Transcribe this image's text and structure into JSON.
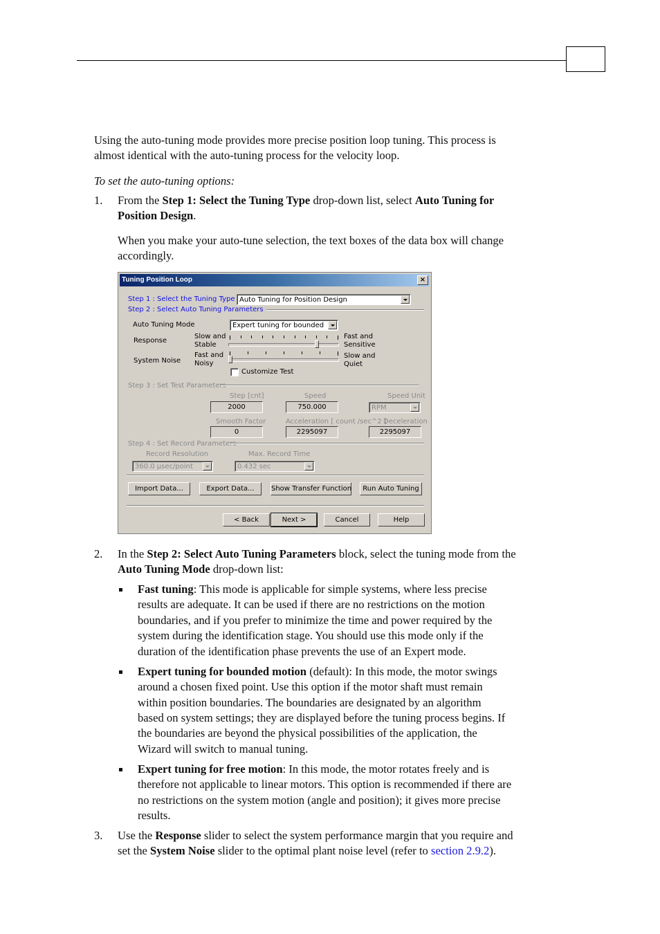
{
  "header": {
    "page_box_label": ""
  },
  "intro": {
    "line1": "Using the auto-tuning mode provides more precise position loop tuning. This process is",
    "line2": "almost identical with the auto-tuning process for the velocity loop.",
    "procedure_title": "To set the auto-tuning options:"
  },
  "steps": [
    {
      "number": "1.",
      "line1_a": "From the ",
      "line1_b": "Step 1: Select the Tuning Type",
      "line1_c": " drop-down list, select ",
      "line1_d": "Auto Tuning for",
      "line2_b": "Position Design",
      "line2_c": ".",
      "note1": "When you make your auto-tune selection, the text boxes of the data box will change",
      "note2": "accordingly."
    },
    {
      "number": "2.",
      "line1_a": "In the ",
      "line1_b": "Step 2: Select Auto Tuning Parameters",
      "line1_c": " block, select the tuning mode from the",
      "line2_b": "Auto Tuning Mode",
      "line2_c": " drop-down list:",
      "bullets": [
        {
          "term": "Fast tuning",
          "lines": [
            ": This mode is applicable for simple systems, where less precise",
            "results are adequate. It can be used if there are no restrictions on the motion",
            "boundaries, and if you prefer to minimize the time and power required by the",
            "system during the identification stage. You should use this mode only if the",
            "duration of the identification phase prevents the use of an Expert mode."
          ]
        },
        {
          "term": "Expert tuning for bounded motion",
          "lines": [
            " (default): In this mode, the motor swings",
            "around a chosen fixed point. Use this option if the motor shaft must remain",
            "within position boundaries. The boundaries are designated by an algorithm",
            "based on system settings; they are displayed before the tuning process begins. If",
            "the boundaries are beyond the physical possibilities of the application, the",
            "Wizard will switch to manual tuning."
          ]
        },
        {
          "term": "Expert tuning for free motion",
          "lines": [
            ": In this mode, the motor rotates freely and is",
            "therefore not applicable to linear motors. This option is recommended if there are",
            "no restrictions on the system motion (angle and position); it gives more precise",
            "results."
          ]
        }
      ]
    },
    {
      "number": "3.",
      "line1_a": "Use the ",
      "line1_b": "Response",
      "line1_c": " slider to select the system performance margin that you require and",
      "line2_a": "set the ",
      "line2_b": "System Noise",
      "line2_c": " slider to the optimal plant noise level (refer to ",
      "link": "section 2.9.2",
      "line2_d": ")."
    }
  ],
  "dialog": {
    "title": "Tuning Position Loop",
    "close_label": "×",
    "step1_label": "Step 1 : Select the  Tuning Type",
    "tuning_type_value": "Auto Tuning for Position Design",
    "step2_label": "Step 2 :  Select Auto Tuning Parameters",
    "auto_tuning_mode_label": "Auto Tuning Mode",
    "auto_tuning_mode_value": "Expert tuning for bounded",
    "response_label": "Response",
    "response_left_1": "Slow and",
    "response_left_2": "Stable",
    "response_right_1": "Fast and",
    "response_right_2": "Sensitive",
    "response_ticks": 11,
    "response_value_fraction": 0.8,
    "noise_label": "System Noise",
    "noise_left_1": "Fast and",
    "noise_left_2": "Noisy",
    "noise_right_1": "Slow and",
    "noise_right_2": "Quiet",
    "noise_ticks": 7,
    "noise_value_fraction": 0.0,
    "customize_label": "Customize Test",
    "customize_checked": false,
    "step3_label": "Step 3 : Set Test  Parameters",
    "step_cnt_label": "Step [cnt]",
    "step_cnt_value": "2000",
    "speed_label": "Speed",
    "speed_value": "750.000",
    "speed_unit_label": "Speed Unit",
    "speed_unit_value": "RPM",
    "smooth_label": "Smooth Factor",
    "smooth_value": "0",
    "accel_label": "Acceleration   [ count /sec^2 ]",
    "accel_value": "2295097",
    "decel_label": "Deceleration",
    "decel_value": "2295097",
    "step4_label": "Step 4 : Set Record Parameters",
    "record_res_label": "Record Resolution",
    "record_res_value": "360.0 µsec/point",
    "max_time_label": "Max. Record Time",
    "max_time_value": "0.432 sec",
    "buttons": {
      "import": "Import Data...",
      "export": "Export Data...",
      "transfer": "Show Transfer Function",
      "run": "Run Auto Tuning",
      "back": "< Back",
      "next": "Next >",
      "cancel": "Cancel",
      "help": "Help"
    }
  }
}
